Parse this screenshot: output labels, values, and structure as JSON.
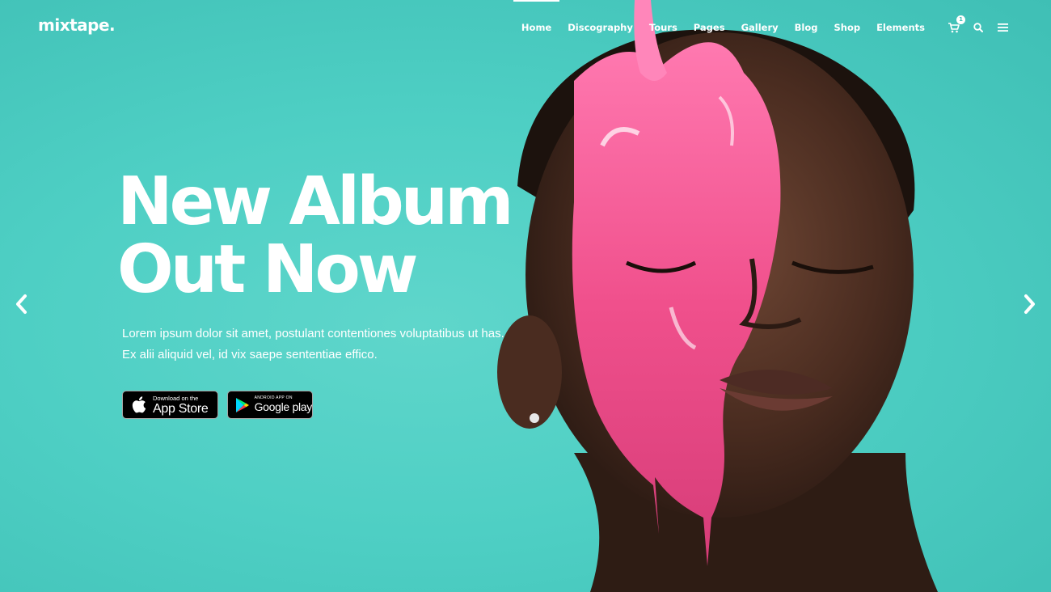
{
  "brand": {
    "logo": "mixtape."
  },
  "nav": {
    "items": [
      {
        "label": "Home",
        "active": true
      },
      {
        "label": "Discography",
        "active": false
      },
      {
        "label": "Tours",
        "active": false
      },
      {
        "label": "Pages",
        "active": false
      },
      {
        "label": "Gallery",
        "active": false
      },
      {
        "label": "Blog",
        "active": false
      },
      {
        "label": "Shop",
        "active": false
      },
      {
        "label": "Elements",
        "active": false
      }
    ],
    "cart_count": "1",
    "icons": [
      "cart-icon",
      "search-icon",
      "menu-icon"
    ]
  },
  "hero": {
    "headline_line1": "New Album",
    "headline_line2": "Out Now",
    "text_line1": "Lorem ipsum dolor sit amet, postulant contentiones voluptatibus ut has.",
    "text_line2": "Ex alii aliquid vel, id vix saepe sententiae effico.",
    "appstore_small": "Download on the",
    "appstore_big": "App Store",
    "google_small": "ANDROID APP ON",
    "google_big": "Google play"
  },
  "slider": {
    "prev_icon": "chevron-left-icon",
    "next_icon": "chevron-right-icon"
  },
  "colors": {
    "background": "#4ecfc4",
    "text": "#ffffff",
    "accent_pink": "#f0508c"
  }
}
